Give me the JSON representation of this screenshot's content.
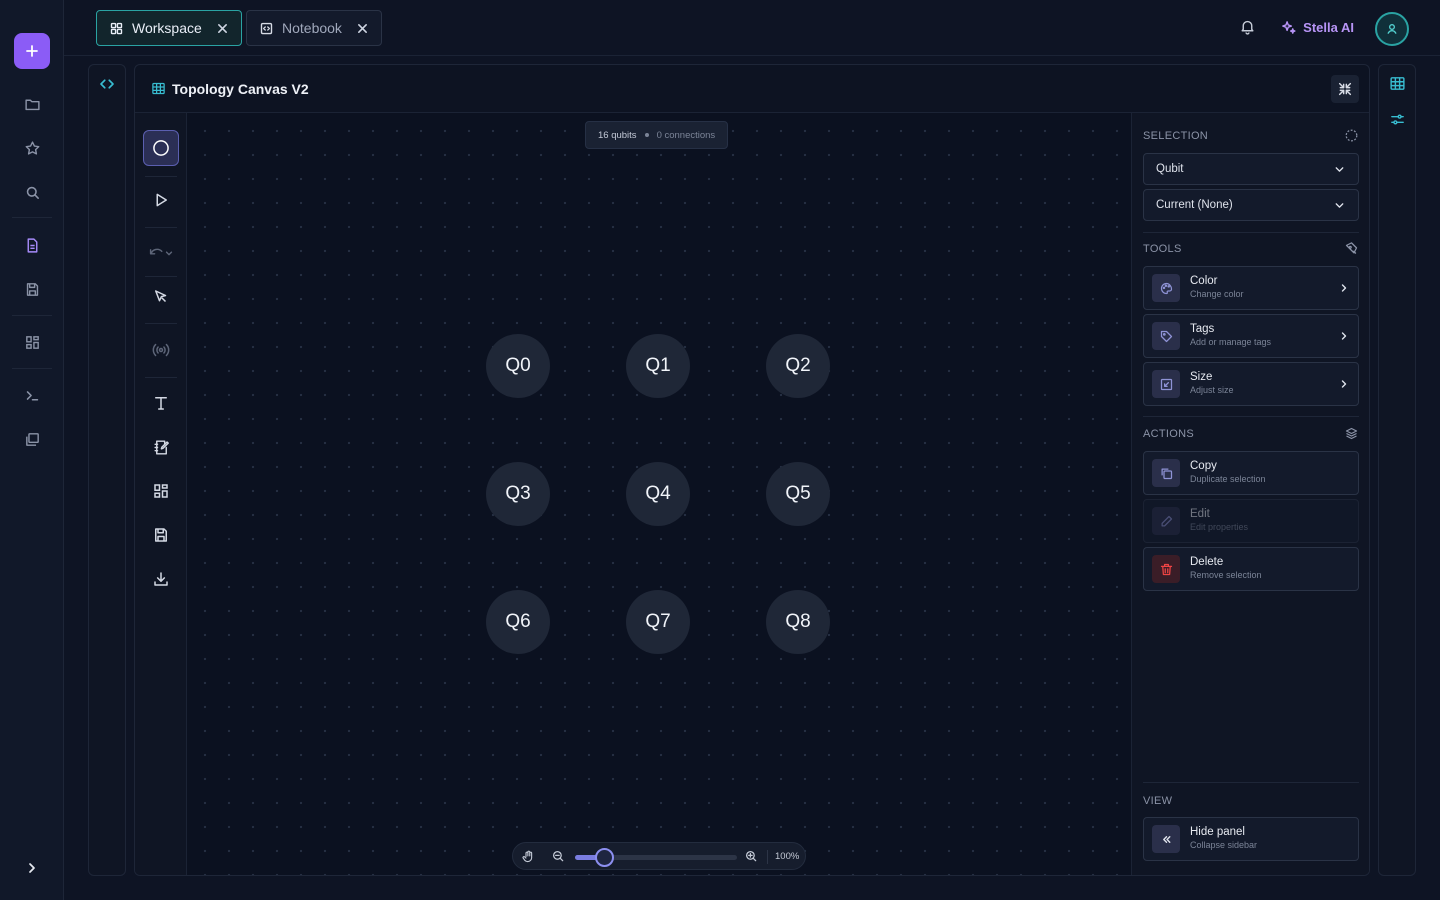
{
  "tabs": [
    {
      "label": "Workspace",
      "icon": "grid-icon",
      "active": true
    },
    {
      "label": "Notebook",
      "icon": "code-file-icon",
      "active": false
    }
  ],
  "header": {
    "assistant_label": "Stella AI"
  },
  "panel": {
    "title": "Topology Canvas V2"
  },
  "canvas": {
    "qubit_count_label": "16 qubits",
    "connection_count_label": "0 connections",
    "qubits": [
      "Q0",
      "Q1",
      "Q2",
      "Q3",
      "Q4",
      "Q5",
      "Q6",
      "Q7",
      "Q8"
    ],
    "zoom": {
      "level_label": "100%",
      "slider_fraction": 0.18
    }
  },
  "inspector": {
    "selection": {
      "title": "SELECTION",
      "type_value": "Qubit",
      "current_value": "Current (None)"
    },
    "tools": {
      "title": "TOOLS",
      "items": [
        {
          "label": "Color",
          "sub": "Change color",
          "icon": "palette-icon"
        },
        {
          "label": "Tags",
          "sub": "Add or manage tags",
          "icon": "tag-icon"
        },
        {
          "label": "Size",
          "sub": "Adjust size",
          "icon": "resize-icon"
        }
      ]
    },
    "actions": {
      "title": "ACTIONS",
      "items": [
        {
          "label": "Copy",
          "sub": "Duplicate selection",
          "icon": "copy-icon",
          "state": "enabled"
        },
        {
          "label": "Edit",
          "sub": "Edit properties",
          "icon": "pencil-icon",
          "state": "disabled"
        },
        {
          "label": "Delete",
          "sub": "Remove selection",
          "icon": "trash-icon",
          "state": "danger"
        }
      ]
    },
    "view": {
      "title": "VIEW",
      "hide_label": "Hide panel",
      "hide_sub": "Collapse sidebar"
    }
  },
  "colors": {
    "accent_purple": "#8b5cf6",
    "accent_teal": "#2aa3a3",
    "danger": "#ef4444",
    "background": "#0e1424"
  }
}
